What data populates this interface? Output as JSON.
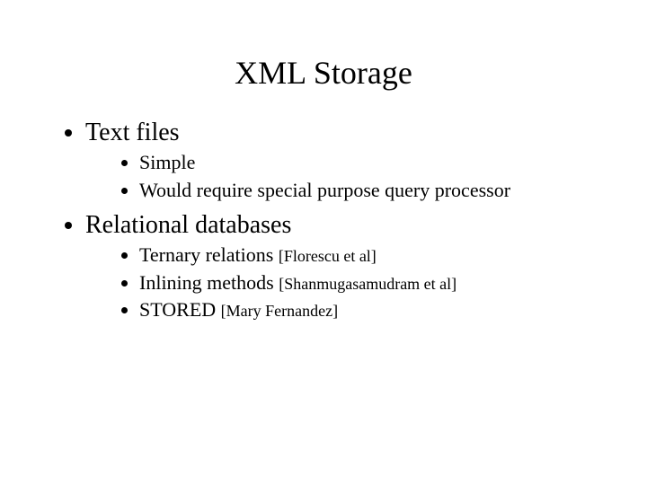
{
  "title": "XML Storage",
  "items": [
    {
      "label": "Text files",
      "sub": [
        {
          "text": "Simple",
          "cite": ""
        },
        {
          "text": "Would require special purpose query processor",
          "cite": ""
        }
      ]
    },
    {
      "label": "Relational databases",
      "sub": [
        {
          "text": "Ternary relations ",
          "cite": "[Florescu et al]"
        },
        {
          "text": "Inlining methods ",
          "cite": "[Shanmugasamudram et al]"
        },
        {
          "text": "STORED ",
          "cite": "[Mary Fernandez]"
        }
      ]
    }
  ]
}
